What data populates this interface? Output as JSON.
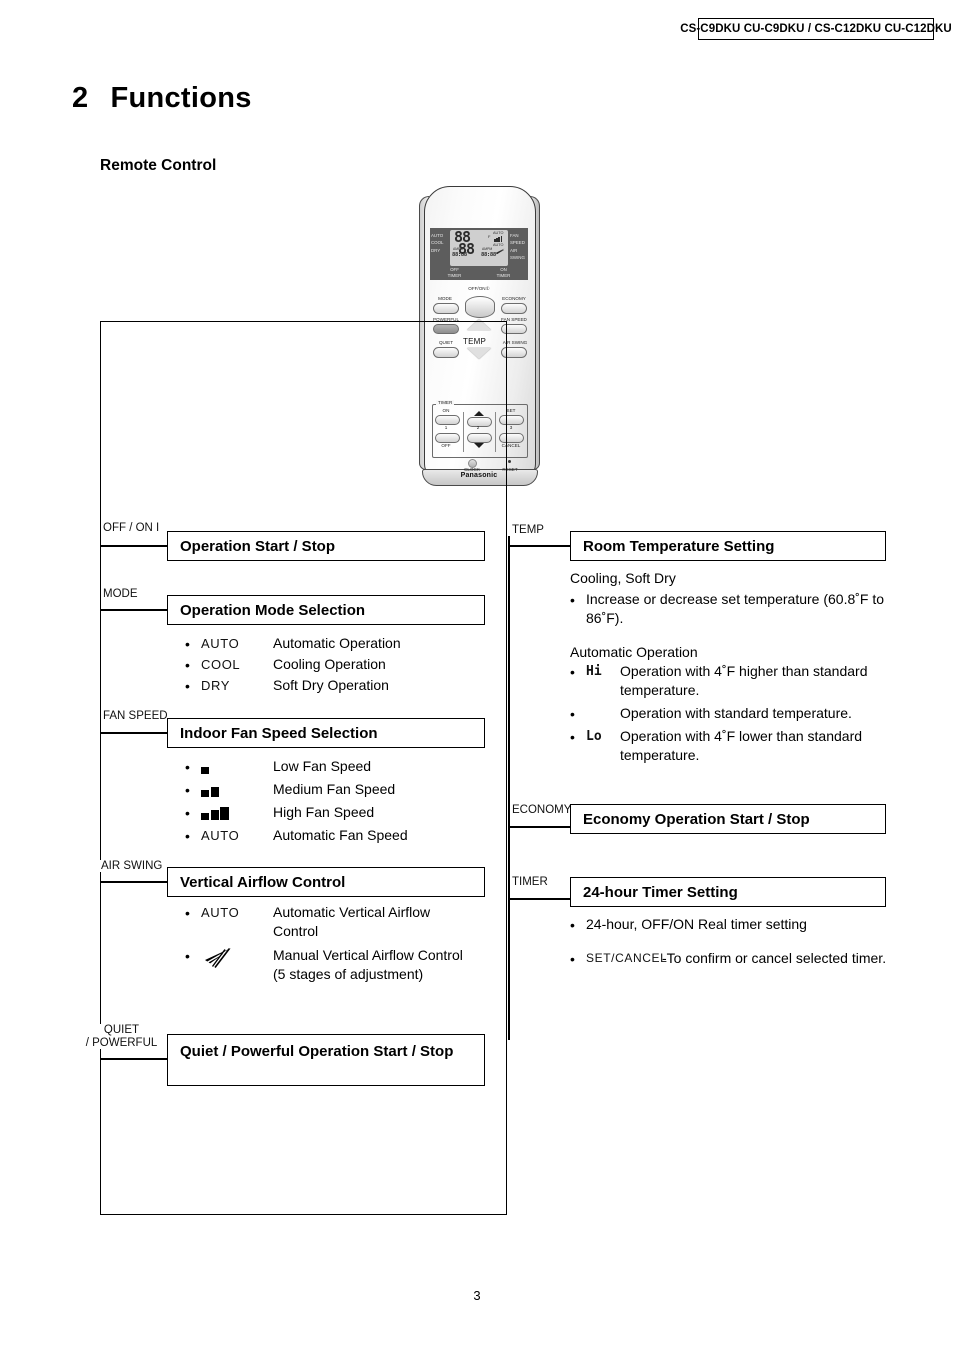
{
  "header": {
    "model_line": "CS-C9DKU CU-C9DKU / CS-C12DKU CU-C12DKU"
  },
  "chapter": {
    "number": "2",
    "title": "Functions"
  },
  "subheading": "Remote Control",
  "page_number": "3",
  "remote": {
    "brand": "Panasonic",
    "lcd": {
      "modes": [
        "AUTO",
        "COOL",
        "DRY"
      ],
      "right_labels": [
        "FAN",
        "SPEED",
        "AIR",
        "SWING"
      ],
      "main_digits": "88",
      "second_digits": "88",
      "unit": "F",
      "fan_auto": "AUTO",
      "swing_auto": "AUTO",
      "off_timer_ampm": "AMPM",
      "on_timer_ampm": "AMPM",
      "off_timer_value": "88:88",
      "on_timer_value": "88:88",
      "off_timer_label_1": "OFF",
      "off_timer_label_2": "TIMER",
      "on_timer_label_1": "ON",
      "on_timer_label_2": "TIMER"
    },
    "buttons": {
      "offon": "OFF/ON",
      "mode": "MODE",
      "economy": "ECONOMY",
      "powerful": "POWERFUL",
      "fan_speed": "FAN SPEED",
      "quiet": "QUIET",
      "air_swing": "AIR SWING",
      "temp": "TEMP",
      "timer_group": "TIMER",
      "timer_on": "ON",
      "timer_off": "OFF",
      "timer_set": "SET",
      "timer_cancel": "CANCEL",
      "num1": "1",
      "num2": "2",
      "num3": "3",
      "clock": "CLOCK",
      "reset": "RESET"
    }
  },
  "left_column": {
    "items": [
      {
        "tag": "OFF / ON",
        "tag_extra": "I",
        "title": "Operation Start / Stop",
        "details": []
      },
      {
        "tag": "MODE",
        "title": "Operation Mode Selection",
        "details": [
          {
            "symbol": "AUTO",
            "text": "Automatic Operation"
          },
          {
            "symbol": "COOL",
            "text": "Cooling Operation"
          },
          {
            "symbol": "DRY",
            "text": "Soft Dry Operation"
          }
        ]
      },
      {
        "tag": "FAN SPEED",
        "title": "Indoor Fan Speed Selection",
        "details": [
          {
            "symbol": "bars-1",
            "text": "Low Fan Speed"
          },
          {
            "symbol": "bars-2",
            "text": "Medium Fan Speed"
          },
          {
            "symbol": "bars-3",
            "text": "High Fan Speed"
          },
          {
            "symbol": "AUTO",
            "text": "Automatic Fan Speed"
          }
        ]
      },
      {
        "tag": "AIR SWING",
        "title": "Vertical Airflow Control",
        "details": [
          {
            "symbol": "AUTO",
            "text": "Automatic Vertical Airflow Control"
          },
          {
            "symbol": "swing",
            "text": "Manual Vertical Airflow Control (5 stages of adjustment)"
          }
        ]
      },
      {
        "tag_line1": "QUIET",
        "tag_line2": "/ POWERFUL",
        "title": "Quiet / Powerful Operation Start / Stop",
        "details": []
      }
    ]
  },
  "right_column": {
    "items": [
      {
        "tag": "TEMP",
        "title": "Room Temperature Setting",
        "group1_heading": "Cooling, Soft Dry",
        "group1_bullets": [
          "Increase or decrease set temperature (60.8˚F to 86˚F)."
        ],
        "group2_heading": "Automatic Operation",
        "group2_bullets": [
          {
            "symbol": "Hi",
            "text": "Operation with 4˚F higher than standard temperature."
          },
          {
            "symbol": "",
            "text": "Operation with standard temperature."
          },
          {
            "symbol": "Lo",
            "text": "Operation with 4˚F lower than standard temperature."
          }
        ]
      },
      {
        "tag": "ECONOMY",
        "title": "Economy Operation Start / Stop",
        "bullets": []
      },
      {
        "tag": "TIMER",
        "title": "24-hour Timer Setting",
        "bullets": [
          {
            "symbol": "",
            "text": "24-hour, OFF/ON Real timer setting"
          },
          {
            "symbol": "SET/CANCEL",
            "text": "-To confirm or cancel selected timer."
          }
        ]
      }
    ]
  }
}
